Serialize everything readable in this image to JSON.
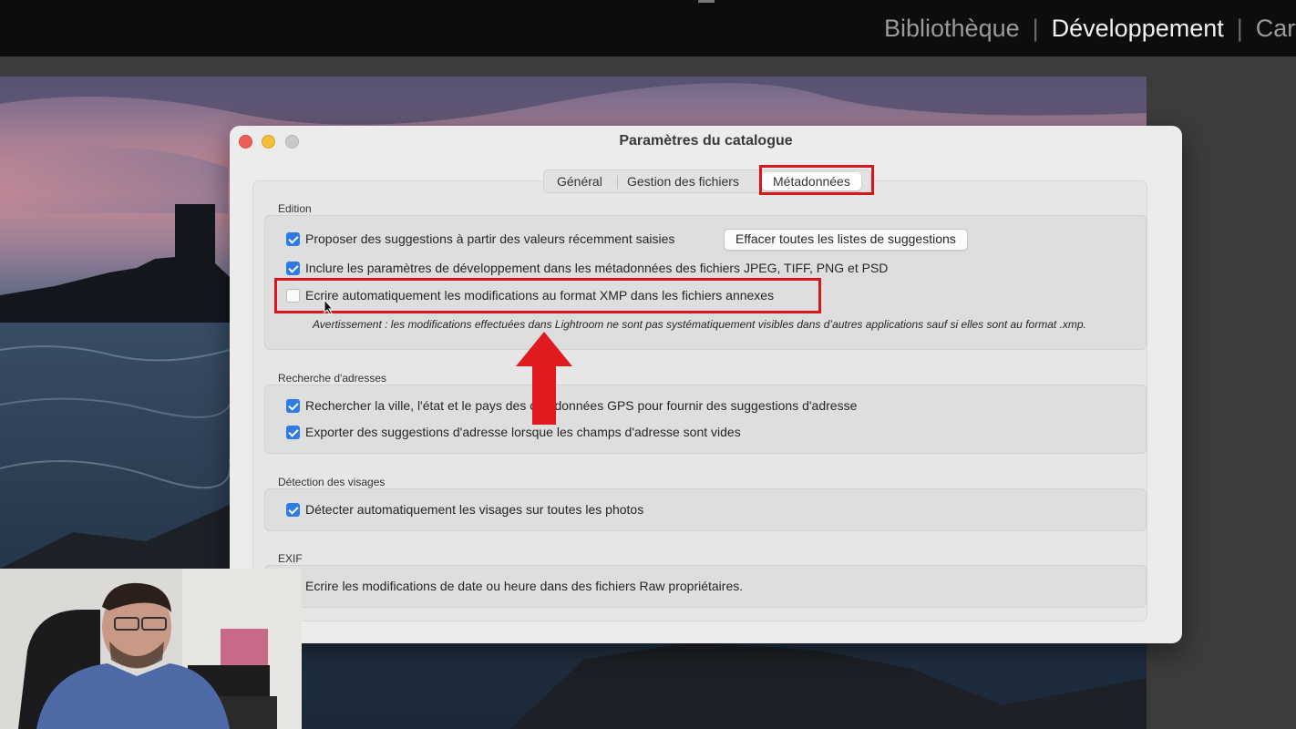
{
  "topbar": {
    "modules": [
      "Bibliothèque",
      "Développement",
      "Cartes"
    ],
    "active_module": "Développement",
    "separator": "|"
  },
  "dialog": {
    "title": "Paramètres du catalogue",
    "tabs": [
      {
        "label": "Général",
        "selected": false
      },
      {
        "label": "Gestion des fichiers",
        "selected": false
      },
      {
        "label": "Métadonnées",
        "selected": true
      }
    ],
    "sections": {
      "edition": {
        "label": "Edition",
        "items": [
          {
            "label": "Proposer des suggestions à partir des valeurs récemment saisies",
            "checked": true
          },
          {
            "label": "Inclure les paramètres de développement dans les métadonnées des fichiers JPEG, TIFF, PNG et PSD",
            "checked": true
          },
          {
            "label": "Ecrire automatiquement les modifications au format XMP dans les fichiers annexes",
            "checked": false
          }
        ],
        "clear_button": "Effacer toutes les listes de suggestions",
        "warning": "Avertissement : les modifications effectuées dans Lightroom ne sont pas systématiquement visibles dans d’autres applications sauf si elles sont au format .xmp."
      },
      "address": {
        "label": "Recherche d'adresses",
        "items": [
          {
            "label": "Rechercher la ville, l'état et le pays des coordonnées GPS pour fournir des suggestions d'adresse",
            "checked": true
          },
          {
            "label": "Exporter des suggestions d'adresse lorsque les champs d'adresse sont vides",
            "checked": true
          }
        ]
      },
      "faces": {
        "label": "Détection des visages",
        "items": [
          {
            "label": "Détecter automatiquement les visages sur toutes les photos",
            "checked": true
          }
        ]
      },
      "exif": {
        "label": "EXIF",
        "items": [
          {
            "label": "Ecrire les modifications de date ou heure dans des fichiers Raw propriétaires.",
            "checked": false
          }
        ]
      }
    }
  },
  "colors": {
    "accent": "#2e7be6",
    "highlight": "#d9161a",
    "close": "#ec5f57",
    "minimize": "#f5bd3a"
  }
}
